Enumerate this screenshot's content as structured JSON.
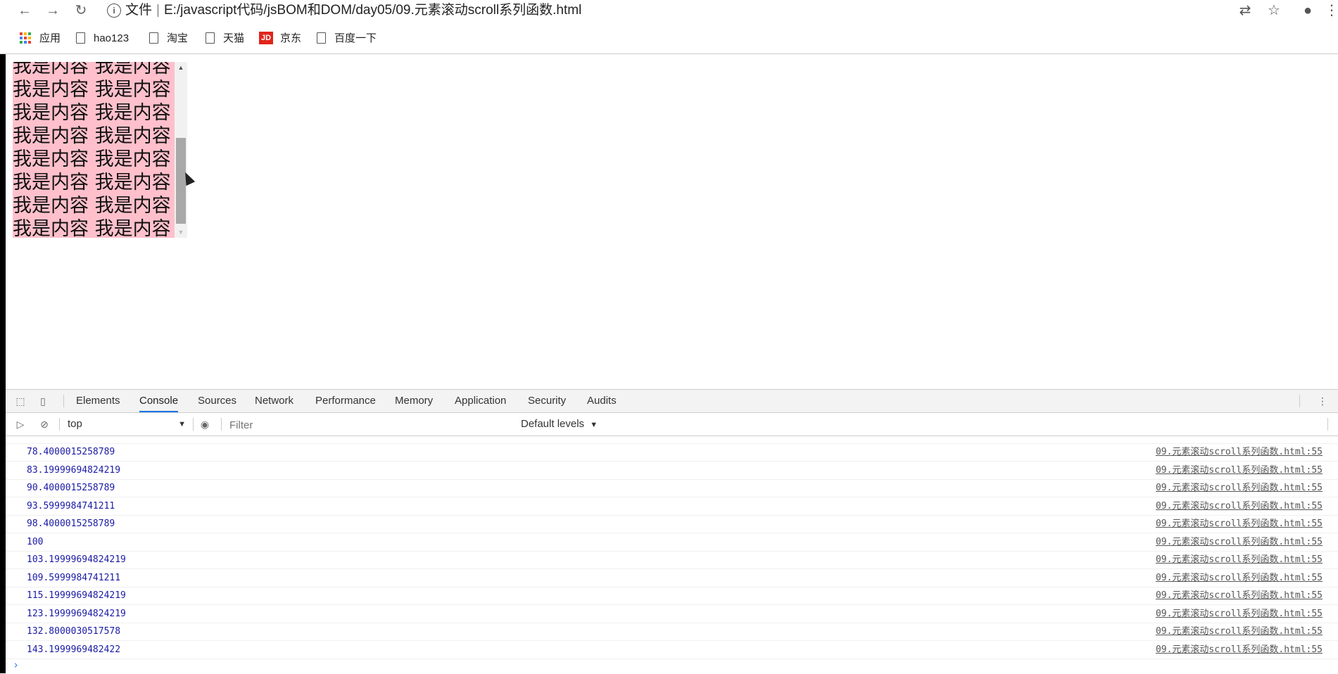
{
  "browser": {
    "address_label": "文件",
    "url": "E:/javascript代码/jsBOM和DOM/day05/09.元素滚动scroll系列函数.html"
  },
  "bookmarks": [
    {
      "label": "应用",
      "icon": "apps-icon"
    },
    {
      "label": "hao123",
      "icon": "page-icon"
    },
    {
      "label": "淘宝",
      "icon": "page-icon"
    },
    {
      "label": "天猫",
      "icon": "page-icon"
    },
    {
      "label": "京东",
      "icon": "jd-logo-icon"
    },
    {
      "label": "百度一下",
      "icon": "page-icon"
    }
  ],
  "jd_logo_text": "JD",
  "content": {
    "line_text": "我是内容 我是内容"
  },
  "devtools": {
    "tabs": [
      "Elements",
      "Console",
      "Sources",
      "Network",
      "Performance",
      "Memory",
      "Application",
      "Security",
      "Audits"
    ],
    "active_tab": "Console",
    "context": "top",
    "filter_placeholder": "Filter",
    "levels": "Default levels",
    "log_source": "09.元素滚动scroll系列函数.html:55",
    "logs": [
      "78.4000015258789",
      "83.19999694824219",
      "90.4000015258789",
      "93.5999984741211",
      "98.4000015258789",
      "100",
      "103.19999694824219",
      "109.5999984741211",
      "115.19999694824219",
      "123.19999694824219",
      "132.8000030517578",
      "143.1999969482422"
    ]
  },
  "colors": {
    "box_bg": "#ffc0cb",
    "log_value": "#1a1aa6",
    "accent": "#1a73e8"
  }
}
